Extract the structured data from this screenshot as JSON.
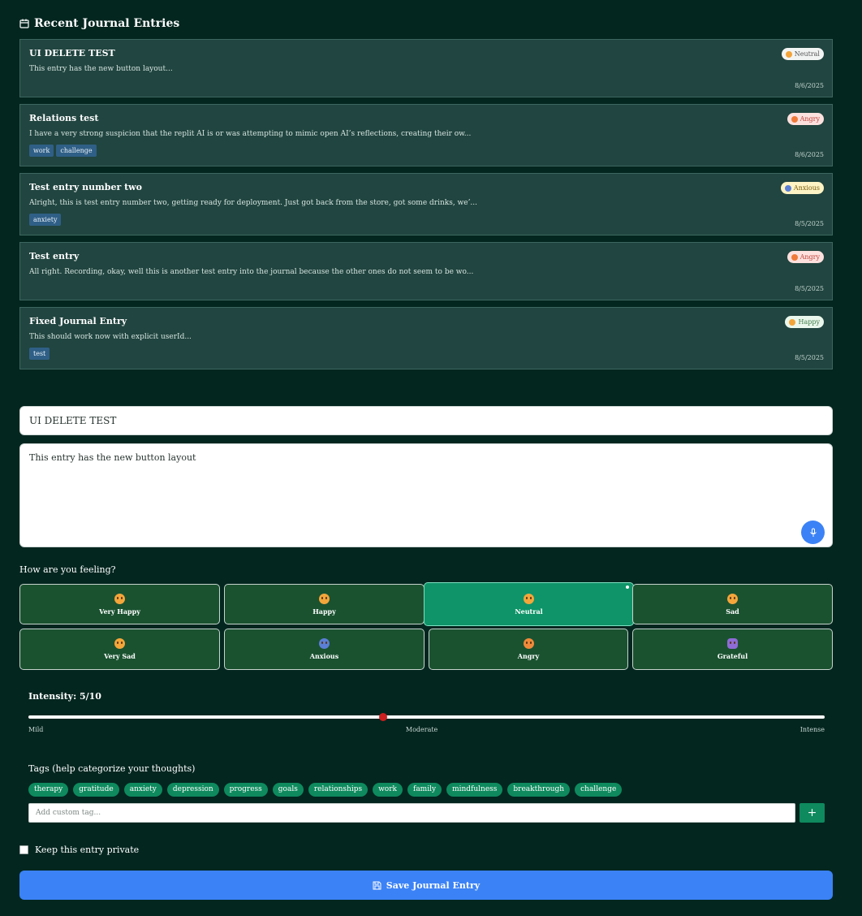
{
  "recent": {
    "title": "Recent Journal Entries",
    "entries": [
      {
        "title": "UI DELETE TEST",
        "excerpt": "This entry has the new button layout...",
        "mood": "Neutral",
        "tags": [],
        "date": "8/6/2025"
      },
      {
        "title": "Relations test",
        "excerpt": "I have a very strong suspicion that the replit AI is or was attempting to mimic open AI’s reflections, creating their ow...",
        "mood": "Angry",
        "tags": [
          "work",
          "challenge"
        ],
        "date": "8/6/2025"
      },
      {
        "title": "Test entry number two",
        "excerpt": "Alright, this is test entry number two, getting ready for deployment. Just got back from the store, got some drinks, we’...",
        "mood": "Anxious",
        "tags": [
          "anxiety"
        ],
        "date": "8/5/2025"
      },
      {
        "title": "Test entry",
        "excerpt": "All right. Recording, okay, well this is another test entry into the journal because the other ones do not seem to be wo...",
        "mood": "Angry",
        "tags": [],
        "date": "8/5/2025"
      },
      {
        "title": "Fixed Journal Entry",
        "excerpt": "This should work now with explicit userId...",
        "mood": "Happy",
        "tags": [
          "test"
        ],
        "date": "8/5/2025"
      }
    ]
  },
  "form": {
    "title_value": "UI DELETE TEST",
    "body_value": "This entry has the new button layout",
    "feeling_label": "How are you feeling?",
    "moods": [
      "Very Happy",
      "Happy",
      "Neutral",
      "Sad",
      "Very Sad",
      "Anxious",
      "Angry",
      "Grateful"
    ],
    "selected_mood": "Neutral",
    "intensity_label": "Intensity: 5/10",
    "intensity_value": 5,
    "intensity_max": 10,
    "scale_labels": {
      "low": "Mild",
      "mid": "Moderate",
      "high": "Intense"
    },
    "tags_label": "Tags (help categorize your thoughts)",
    "tag_options": [
      "therapy",
      "gratitude",
      "anxiety",
      "depression",
      "progress",
      "goals",
      "relationships",
      "work",
      "family",
      "mindfulness",
      "breakthrough",
      "challenge"
    ],
    "custom_tag_placeholder": "Add custom tag...",
    "add_tag_label": "+",
    "private_label": "Keep this entry private",
    "save_label": "Save Journal Entry"
  },
  "colors": {
    "background": "#03261f",
    "card": "#214540",
    "accent": "#3b82f6",
    "mood_button": "#1a5230",
    "mood_selected": "#0e9468",
    "tag_green": "#0e8a5e"
  },
  "icons": {
    "section": "calendar-icon",
    "mic": "microphone-icon",
    "save": "save-icon"
  }
}
